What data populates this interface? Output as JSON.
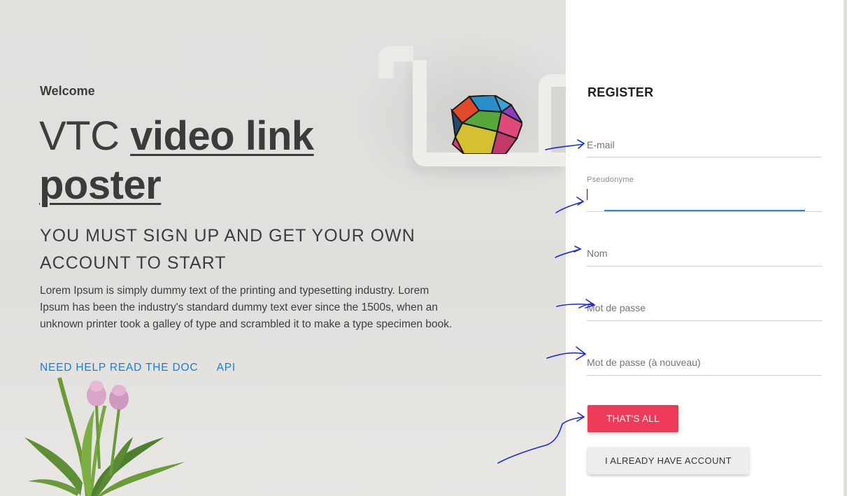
{
  "hero": {
    "welcome": "Welcome",
    "title_prefix": "VTC",
    "title_brand": "video link poster",
    "subtitle": "YOU MUST SIGN UP AND GET YOUR OWN ACCOUNT TO START",
    "description": "Lorem Ipsum is simply dummy text of the printing and typesetting industry. Lorem Ipsum has been the industry's standard dummy text ever since the 1500s, when an unknown printer took a galley of type and scrambled it to make a type specimen book.",
    "links": [
      {
        "label": "NEED HELP READ THE DOC"
      },
      {
        "label": "API"
      }
    ]
  },
  "register": {
    "title": "REGISTER",
    "email_placeholder": "E-mail",
    "pseudonyme_label": "Pseudonyme",
    "pseudonyme_value": "",
    "nom_placeholder": "Nom",
    "password_placeholder": "Mot de passe",
    "password_confirm_placeholder": "Mot de passe (à nouveau)",
    "submit_label": "THAT'S ALL",
    "have_account_label": "I ALREADY HAVE ACCOUNT"
  },
  "colors": {
    "accent": "#ee3b59",
    "link": "#1e7bd3",
    "focus": "#2b88d8",
    "annotation": "#1a2bd6"
  }
}
